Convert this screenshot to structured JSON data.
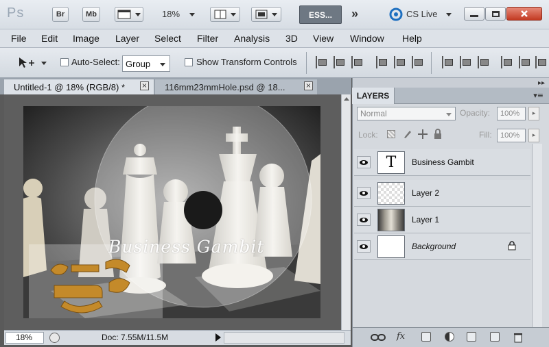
{
  "app": {
    "logo": "Ps",
    "bridge_label": "Br",
    "minibridge_label": "Mb",
    "zoom": "18%",
    "workspace": "ESS...",
    "more": "»",
    "cslive": "CS Live"
  },
  "menu": [
    "File",
    "Edit",
    "Image",
    "Layer",
    "Select",
    "Filter",
    "Analysis",
    "3D",
    "View",
    "Window",
    "Help"
  ],
  "options": {
    "auto_select_label": "Auto-Select:",
    "auto_select_value": "Group",
    "transform_label": "Show Transform Controls"
  },
  "tabs": [
    {
      "label": "Untitled-1 @ 18% (RGB/8) *",
      "close": "×"
    },
    {
      "label": "116mm23mmHole.psd @ 18...",
      "close": "×"
    }
  ],
  "canvas": {
    "text": "Business Gambit"
  },
  "status": {
    "zoom": "18%",
    "doc": "Doc: 7.55M/11.5M"
  },
  "layers_panel": {
    "title": "LAYERS",
    "blend_mode": "Normal",
    "opacity_label": "Opacity:",
    "opacity": "100%",
    "lock_label": "Lock:",
    "fill_label": "Fill:",
    "fill": "100%",
    "layers": [
      {
        "name": "Business Gambit",
        "thumb": "T",
        "visible": true
      },
      {
        "name": "Layer 2",
        "visible": true
      },
      {
        "name": "Layer 1",
        "visible": true
      },
      {
        "name": "Background",
        "visible": true,
        "locked": true
      }
    ]
  }
}
